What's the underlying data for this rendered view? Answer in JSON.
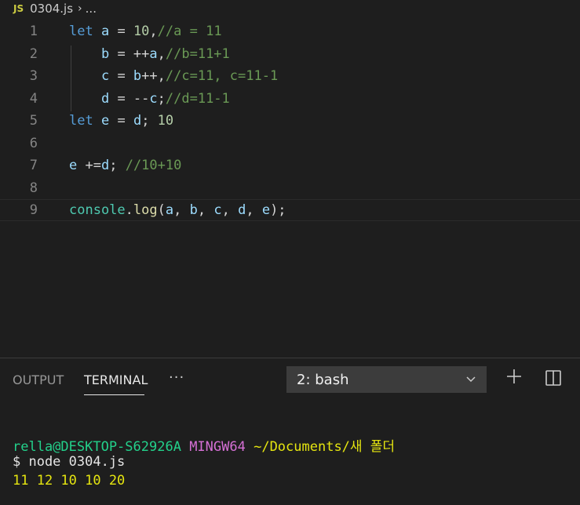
{
  "breadcrumb": {
    "badge": "JS",
    "file": "0304.js",
    "sep": "›",
    "more": "..."
  },
  "editor": {
    "lines": [
      {
        "num": "1",
        "tokens": [
          {
            "t": "let",
            "c": "kw"
          },
          {
            "t": " ",
            "c": "op"
          },
          {
            "t": "a",
            "c": "var"
          },
          {
            "t": " = ",
            "c": "op"
          },
          {
            "t": "10",
            "c": "num"
          },
          {
            "t": ",",
            "c": "op"
          },
          {
            "t": "//a = 11",
            "c": "cm"
          }
        ]
      },
      {
        "num": "2",
        "tokens": [
          {
            "t": "    ",
            "c": "op"
          },
          {
            "t": "b",
            "c": "var"
          },
          {
            "t": " = ++",
            "c": "op"
          },
          {
            "t": "a",
            "c": "var"
          },
          {
            "t": ",",
            "c": "op"
          },
          {
            "t": "//b=11+1",
            "c": "cm"
          }
        ]
      },
      {
        "num": "3",
        "tokens": [
          {
            "t": "    ",
            "c": "op"
          },
          {
            "t": "c",
            "c": "var"
          },
          {
            "t": " = ",
            "c": "op"
          },
          {
            "t": "b",
            "c": "var"
          },
          {
            "t": "++,",
            "c": "op"
          },
          {
            "t": "//c=11, c=11-1",
            "c": "cm"
          }
        ]
      },
      {
        "num": "4",
        "tokens": [
          {
            "t": "    ",
            "c": "op"
          },
          {
            "t": "d",
            "c": "var"
          },
          {
            "t": " = --",
            "c": "op"
          },
          {
            "t": "c",
            "c": "var"
          },
          {
            "t": ";",
            "c": "op"
          },
          {
            "t": "//d=11-1",
            "c": "cm"
          }
        ]
      },
      {
        "num": "5",
        "tokens": [
          {
            "t": "let",
            "c": "kw"
          },
          {
            "t": " ",
            "c": "op"
          },
          {
            "t": "e",
            "c": "var"
          },
          {
            "t": " = ",
            "c": "op"
          },
          {
            "t": "d",
            "c": "var"
          },
          {
            "t": "; ",
            "c": "op"
          },
          {
            "t": "10",
            "c": "num"
          }
        ]
      },
      {
        "num": "6",
        "tokens": []
      },
      {
        "num": "7",
        "tokens": [
          {
            "t": "e",
            "c": "var"
          },
          {
            "t": " +=",
            "c": "op"
          },
          {
            "t": "d",
            "c": "var"
          },
          {
            "t": "; ",
            "c": "op"
          },
          {
            "t": "//10+10",
            "c": "cm"
          }
        ]
      },
      {
        "num": "8",
        "tokens": []
      },
      {
        "num": "9",
        "tokens": [
          {
            "t": "console",
            "c": "obj"
          },
          {
            "t": ".",
            "c": "op"
          },
          {
            "t": "log",
            "c": "fn"
          },
          {
            "t": "(",
            "c": "op"
          },
          {
            "t": "a",
            "c": "var"
          },
          {
            "t": ", ",
            "c": "op"
          },
          {
            "t": "b",
            "c": "var"
          },
          {
            "t": ", ",
            "c": "op"
          },
          {
            "t": "c",
            "c": "var"
          },
          {
            "t": ", ",
            "c": "op"
          },
          {
            "t": "d",
            "c": "var"
          },
          {
            "t": ", ",
            "c": "op"
          },
          {
            "t": "e",
            "c": "var"
          },
          {
            "t": ");",
            "c": "op"
          }
        ]
      }
    ]
  },
  "panel": {
    "tab_output": "OUTPUT",
    "tab_terminal": "TERMINAL",
    "more": "···",
    "terminal_select": "2: bash",
    "icons": [
      "chevron-down-icon",
      "plus-icon",
      "split-icon"
    ]
  },
  "terminal": {
    "prompt_user": "rella@DESKTOP-S62926A",
    "prompt_env": "MINGW64",
    "prompt_path": "~/Documents/새 폴더",
    "command": "$ node 0304.js",
    "output": "11 12 10 10 20"
  },
  "colors": {
    "keyword": "#569cd6",
    "variable": "#9cdcfe",
    "number": "#b5cea8",
    "comment": "#6a9955",
    "background": "#1e1e1e"
  }
}
